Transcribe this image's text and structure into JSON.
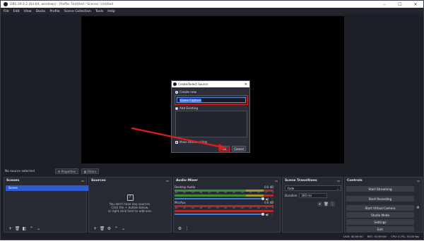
{
  "window": {
    "title": "OBS 29.0.2 (64-bit, windows) - Profile: Untitled - Scenes: Untitled",
    "minimize": "–",
    "maximize": "☐",
    "close": "✕"
  },
  "menu": [
    "File",
    "Edit",
    "View",
    "Docks",
    "Profile",
    "Scene Collection",
    "Tools",
    "Help"
  ],
  "dialog": {
    "title": "Create/Select Source",
    "close": "✕",
    "create_new_label": "Create new",
    "name_value": "Game Capture",
    "add_existing_label": "Add Existing",
    "make_visible_label": "Make source visible",
    "ok_label": "OK",
    "cancel_label": "Cancel"
  },
  "source_bar": {
    "no_source": "No source selected",
    "properties": "Properties",
    "filters": "Filters"
  },
  "scenes": {
    "title": "Scenes",
    "items": [
      "Scene"
    ]
  },
  "sources": {
    "title": "Sources",
    "empty_line1": "You don't have any sources.",
    "empty_line2": "Click the + button below,",
    "empty_line3": "or right click here to add one."
  },
  "mixer": {
    "title": "Audio Mixer",
    "tracks": [
      {
        "name": "Desktop Audio",
        "db": "0.0 dB",
        "muted": false
      },
      {
        "name": "Mic/Aux",
        "db": "0.0 dB",
        "muted": false
      }
    ],
    "ticks": [
      "-60",
      "-55",
      "-50",
      "-45",
      "-40",
      "-35",
      "-30",
      "-25",
      "-20",
      "-15",
      "-10",
      "-5",
      "0"
    ]
  },
  "transitions": {
    "title": "Scene Transitions",
    "selected": "Fade",
    "duration_label": "Duration",
    "duration_value": "300 ms"
  },
  "controls": {
    "title": "Controls",
    "buttons": [
      "Start Streaming",
      "Start Recording",
      "Start Virtual Camera",
      "Studio Mode",
      "Settings",
      "Exit"
    ]
  },
  "status": {
    "live": "LIVE: 00:00:00",
    "rec": "REC: 00:00:00",
    "cpu": "CPU: 0.7%, 30.00 fps"
  },
  "colors": {
    "accent": "#2f5bd0",
    "annotation": "#e01e1e"
  }
}
